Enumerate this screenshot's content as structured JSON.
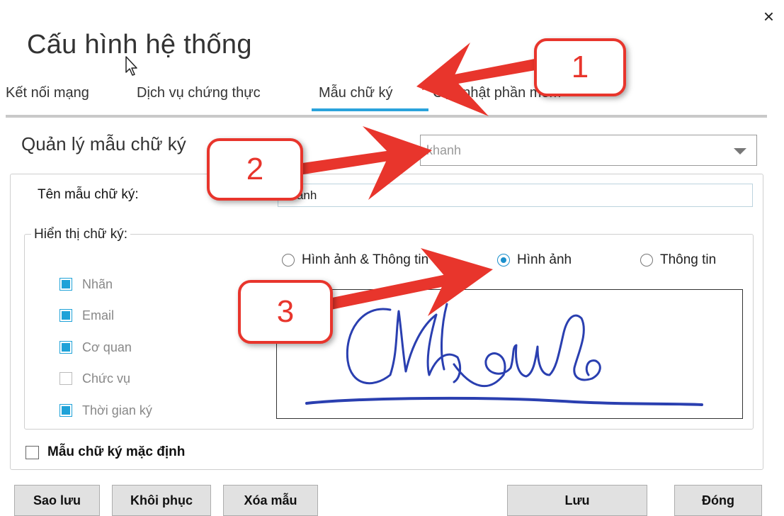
{
  "dialog": {
    "title": "Cấu hình hệ thống",
    "close_glyph": "×",
    "tabs": [
      {
        "label": "Kết nối mạng",
        "active": false
      },
      {
        "label": "Dịch vụ chứng thực",
        "active": false
      },
      {
        "label": "Mẫu chữ ký",
        "active": true
      },
      {
        "label": "Cập nhật phần mềm",
        "active": false
      }
    ],
    "section_title": "Quản lý mẫu chữ ký",
    "template_select": {
      "value": "khanh"
    },
    "name_label": "Tên mẫu chữ ký:",
    "name_value": "khanh",
    "display_legend": "Hiển thị chữ ký:",
    "checkboxes": [
      {
        "label": "Nhãn",
        "checked": true
      },
      {
        "label": "Email",
        "checked": true
      },
      {
        "label": "Cơ quan",
        "checked": true
      },
      {
        "label": "Chức vụ",
        "checked": false
      },
      {
        "label": "Thời gian ký",
        "checked": true
      }
    ],
    "radios": [
      {
        "label": "Hình ảnh & Thông tin",
        "selected": false
      },
      {
        "label": "Hình ảnh",
        "selected": true
      },
      {
        "label": "Thông tin",
        "selected": false
      }
    ],
    "default_checkbox": {
      "label": "Mẫu chữ ký mặc định",
      "checked": false
    },
    "buttons": {
      "backup": "Sao lưu",
      "restore": "Khôi phục",
      "delete": "Xóa mẫu",
      "save": "Lưu",
      "close": "Đóng"
    }
  },
  "annotations": {
    "callouts": [
      "1",
      "2",
      "3"
    ],
    "color": "#e8352c"
  },
  "colors": {
    "accent": "#2aa3dc",
    "checkbox_fill": "#1fa2d8",
    "signature_ink": "#2a3fb0"
  }
}
